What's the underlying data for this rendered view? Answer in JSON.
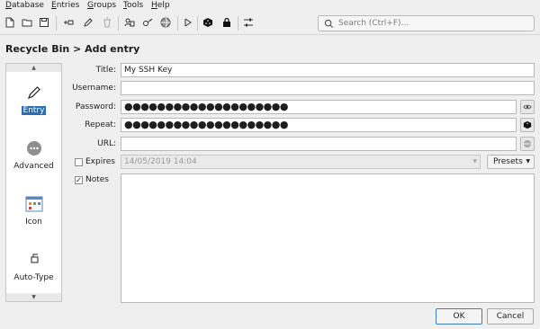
{
  "menu": [
    {
      "label": "Database",
      "key": "D"
    },
    {
      "label": "Entries",
      "key": "E"
    },
    {
      "label": "Groups",
      "key": "G"
    },
    {
      "label": "Tools",
      "key": "T"
    },
    {
      "label": "Help",
      "key": "H"
    }
  ],
  "search": {
    "placeholder": "Search (Ctrl+F)..."
  },
  "page_title": "Recycle Bin > Add entry",
  "categories": [
    {
      "label": "Entry",
      "icon": "pencil-icon",
      "selected": true
    },
    {
      "label": "Advanced",
      "icon": "more-icon",
      "selected": false
    },
    {
      "label": "Icon",
      "icon": "icon-grid-icon",
      "selected": false
    },
    {
      "label": "Auto-Type",
      "icon": "keyboard-icon",
      "selected": false
    }
  ],
  "form": {
    "title_label": "Title:",
    "title_value": "My SSH Key",
    "username_label": "Username:",
    "username_value": "",
    "password_label": "Password:",
    "password_value": "●●●●●●●●●●●●●●●●●●●●",
    "repeat_label": "Repeat:",
    "repeat_value": "●●●●●●●●●●●●●●●●●●●●",
    "url_label": "URL:",
    "url_value": "",
    "expires_label": "Expires",
    "expires_checked": false,
    "expires_value": "14/05/2019 14:04",
    "presets_label": "Presets",
    "notes_label": "Notes",
    "notes_checked": true,
    "notes_value": ""
  },
  "buttons": {
    "ok": "OK",
    "cancel": "Cancel"
  },
  "colors": {
    "selection": "#2a6db1",
    "background": "#efefef"
  }
}
